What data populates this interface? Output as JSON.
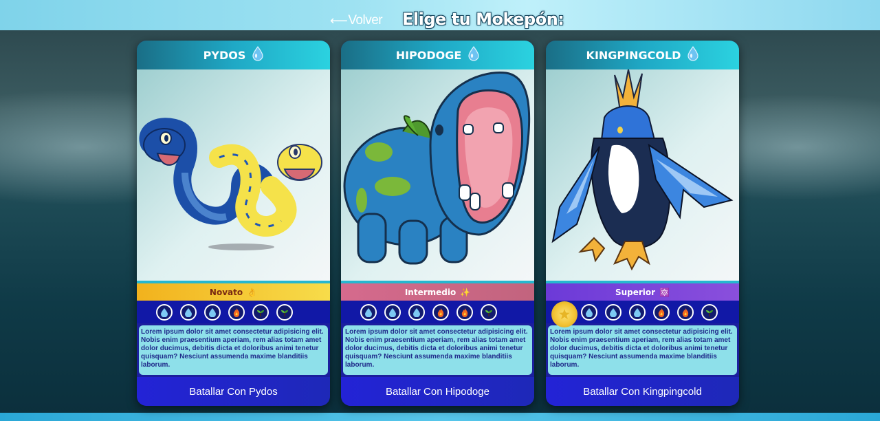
{
  "header": {
    "back_arrow": "⟵",
    "back_label": "Volver",
    "title": "Elige tu Mokepón:"
  },
  "cards": [
    {
      "name": "PYDOS",
      "type_icon": "water-drop-icon",
      "level": "Novato",
      "level_emoji": "👌",
      "attacks": [
        "water-drop-icon",
        "water-drop-icon",
        "water-drop-icon",
        "fire-icon",
        "sprout-icon",
        "sprout-icon"
      ],
      "description": "Lorem ipsum dolor sit amet consectetur adipisicing elit. Nobis enim praesentium aperiam, rem alias totam amet dolor ducimus, debitis dicta et doloribus animi tenetur quisquam? Nesciunt assumenda maxime blanditiis laborum.",
      "button": "Batallar Con Pydos"
    },
    {
      "name": "HIPODOGE",
      "type_icon": "water-drop-icon",
      "level": "Intermedio",
      "level_emoji": "✨",
      "attacks": [
        "water-drop-icon",
        "water-drop-icon",
        "water-drop-icon",
        "fire-icon",
        "fire-icon",
        "sprout-icon"
      ],
      "description": "Lorem ipsum dolor sit amet consectetur adipisicing elit. Nobis enim praesentium aperiam, rem alias totam amet dolor ducimus, debitis dicta et doloribus animi tenetur quisquam? Nesciunt assumenda maxime blanditiis laborum.",
      "button": "Batallar Con Hipodoge"
    },
    {
      "name": "KINGPINGCOLD",
      "type_icon": "water-drop-icon",
      "level": "Superior",
      "level_emoji": "🔯",
      "attacks": [
        "gold-medal-icon",
        "water-drop-icon",
        "water-drop-icon",
        "water-drop-icon",
        "fire-icon",
        "fire-icon",
        "sprout-icon"
      ],
      "description": "Lorem ipsum dolor sit amet consectetur adipisicing elit. Nobis enim praesentium aperiam, rem alias totam amet dolor ducimus, debitis dicta et doloribus animi tenetur quisquam? Nesciunt assumenda maxime blanditiis laborum.",
      "button": "Batallar Con Kingpingcold"
    }
  ],
  "colors": {
    "accent_blue": "#1e28b8",
    "card_header": "#1fa8c5",
    "description_bg": "#8ee0ea"
  }
}
